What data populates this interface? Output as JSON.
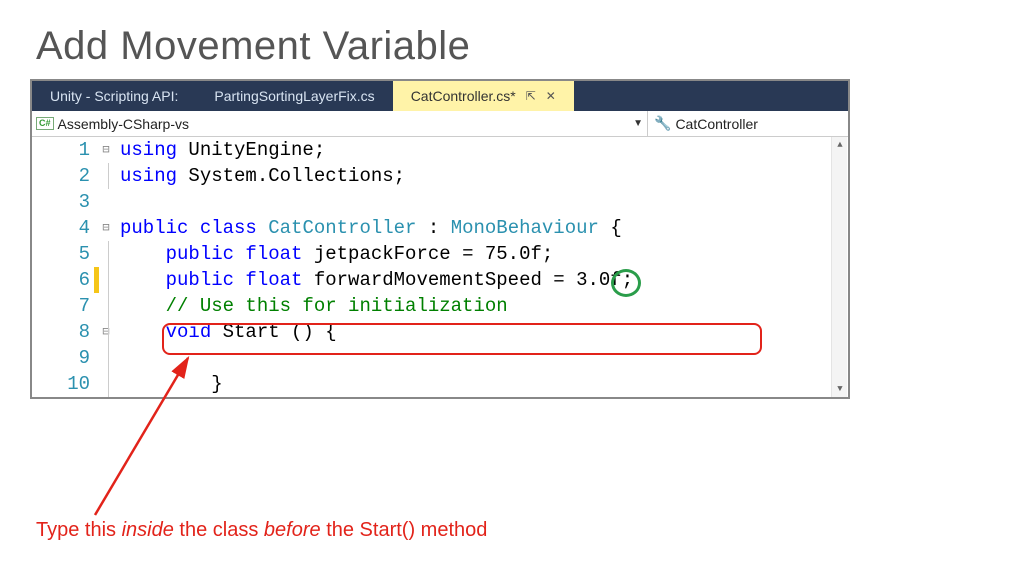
{
  "title": "Add Movement Variable",
  "tabs": {
    "t1": "Unity - Scripting API:",
    "t2": "PartingSortingLayerFix.cs",
    "t3": "CatController.cs*"
  },
  "nav": {
    "left": "Assembly-CSharp-vs",
    "right": "CatController"
  },
  "code": {
    "l1a": "using",
    "l1b": " UnityEngine;",
    "l2a": "using",
    "l2b": " System.Collections;",
    "l4a": "public class ",
    "l4b": "CatController",
    "l4c": " : ",
    "l4d": "MonoBehaviour",
    "l4e": " {",
    "l5a": "    public float",
    "l5b": " jetpackForce = 75.0f;",
    "l6a": "    public float",
    "l6b": " forwardMovementSpeed = 3.0f;",
    "l7": "    // Use this for initialization",
    "l8a": "    void",
    "l8b": " Start () {",
    "l10": "        }"
  },
  "linenos": [
    "1",
    "2",
    "3",
    "4",
    "5",
    "6",
    "7",
    "8",
    "9",
    "10"
  ],
  "caption": {
    "p1": "Type this ",
    "p2": "inside",
    "p3": " the class ",
    "p4": "before",
    "p5": " the Start() method"
  }
}
